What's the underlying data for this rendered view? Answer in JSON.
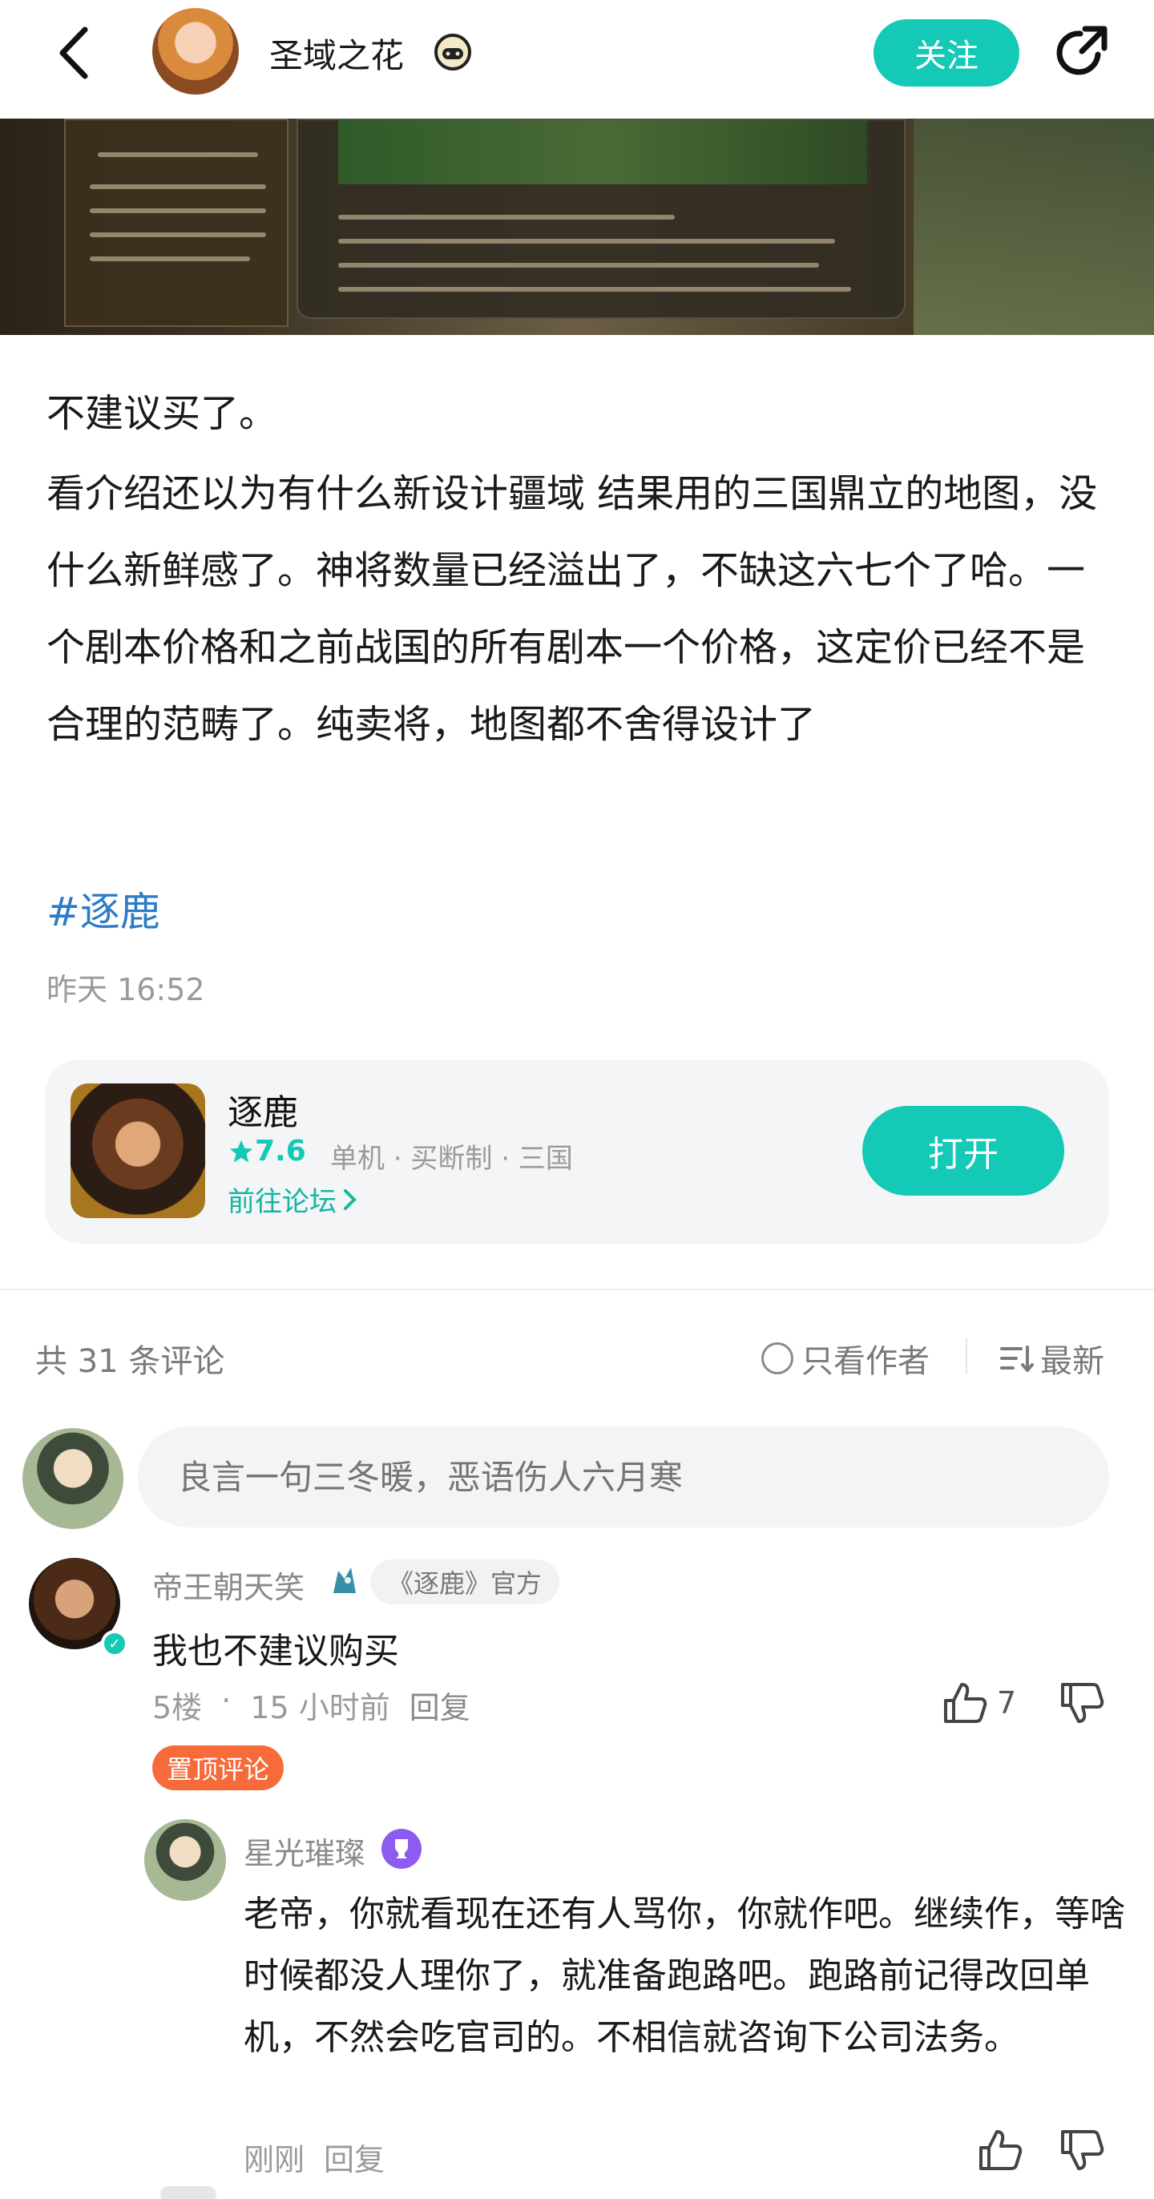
{
  "header": {
    "user_name": "圣域之花",
    "follow_label": "关注"
  },
  "post": {
    "title": "不建议买了。",
    "body": "看介绍还以为有什么新设计疆域 结果用的三国鼎立的地图，没什么新鲜感了。神将数量已经溢出了，不缺这六七个了哈。一个剧本价格和之前战国的所有剧本一个价格，这定价已经不是合理的范畴了。纯卖将，地图都不舍得设计了",
    "hashtag": "#逐鹿",
    "time": "昨天 16:52"
  },
  "game_card": {
    "name": "逐鹿",
    "rating": "7.6",
    "tags": "单机 · 买断制 · 三国",
    "forum_link": "前往论坛",
    "open_label": "打开"
  },
  "comments": {
    "count_label": "共 31 条评论",
    "author_only_label": "只看作者",
    "sort_label": "最新",
    "input_placeholder": "良言一句三冬暖，恶语伤人六月寒",
    "items": [
      {
        "name": "帝王朝天笑",
        "official_tag": "《逐鹿》官方",
        "text": "我也不建议购买",
        "floor": "5楼",
        "time": "15 小时前",
        "reply_label": "回复",
        "likes": "7",
        "pinned_label": "置顶评论",
        "replies": [
          {
            "name": "星光璀璨",
            "text": "老帝，你就看现在还有人骂你，你就作吧。继续作，等啥时候都没人理你了，就准备跑路吧。跑路前记得改回单机，不然会吃官司的。不相信就咨询下公司法务。",
            "time": "刚刚",
            "reply_label": "回复"
          }
        ]
      }
    ]
  },
  "colors": {
    "accent": "#14c9b5",
    "hashtag": "#2d7bc6",
    "pinned": "#f76a3a",
    "badge_purple": "#8d5bf0"
  },
  "icons": [
    "back-arrow-icon",
    "game-controller-badge-icon",
    "share-icon",
    "star-icon",
    "chevron-right-icon",
    "circle-radio-icon",
    "sort-icon",
    "verified-icon",
    "thumbs-up-icon",
    "thumbs-down-icon",
    "trophy-badge-icon"
  ]
}
